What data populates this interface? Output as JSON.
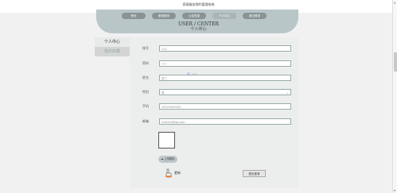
{
  "app": {
    "title": "家政服务预约管理系统"
  },
  "nav": {
    "tabs": [
      {
        "label": "首页",
        "active": false
      },
      {
        "label": "家政服务",
        "active": false
      },
      {
        "label": "公告信息",
        "active": false
      },
      {
        "label": "个人中心",
        "active": true
      },
      {
        "label": "退出登录",
        "active": false
      }
    ]
  },
  "user_center": {
    "title": "USER / CENTER",
    "subtitle": "个人中心"
  },
  "sidebar": {
    "items": [
      {
        "label": "个人中心",
        "selected": true
      },
      {
        "label": "我的收藏",
        "selected": false
      }
    ]
  },
  "form": {
    "account": {
      "label": "账号",
      "value": "111"
    },
    "password": {
      "label": "密码",
      "value": "•••"
    },
    "name": {
      "label": "姓名",
      "value": "张三"
    },
    "gender": {
      "label": "性别",
      "value": "男"
    },
    "phone": {
      "label": "手机",
      "value": "19129492542"
    },
    "email": {
      "label": "邮箱",
      "value": "yuqhhy@qq.com"
    }
  },
  "buttons": {
    "upload": "上传图片",
    "update": "更新",
    "logout": "退出登录"
  },
  "colors": {
    "header_panel": "#b8c6c8",
    "tab": "#8a9293",
    "tab_active": "#a9b4b5",
    "background": "#f1f1f1"
  }
}
